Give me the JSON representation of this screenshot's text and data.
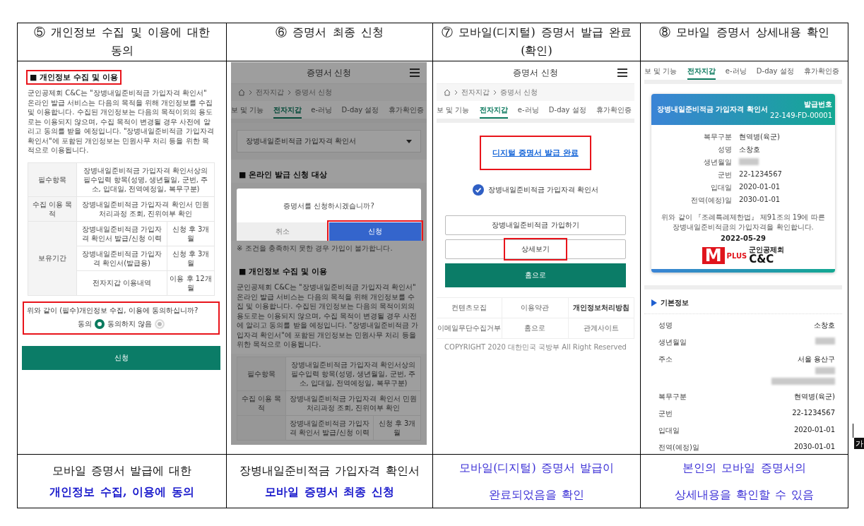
{
  "columns": [
    {
      "header": "⑤ 개인정보 수집 및 이용에 대한 동의",
      "screen": {
        "dimmed": false,
        "blocks": [
          {
            "kind": "heading",
            "text": "■ 개인정보 수집 및 이용",
            "highlighted": true
          },
          {
            "kind": "paragraph",
            "text": "군인공제회 C&C는 \"장병내일준비적금 가입자격 확인서\" 온라인 발급 서비스는 다음의 목적을 위해 개인정보를 수집 및 이용합니다. 수집된 개인정보는 다음의 목적이외의 용도로는 이용되지 않으며, 수집 목적이 변경될 경우 사전에 알리고 동의를 받을 예정입니다. \"장병내일준비적금 가입자격 확인서\"에 포함된 개인정보는 민원사무 처리 등을 위한 목적으로 이용됩니다."
          },
          {
            "kind": "table",
            "rows": [
              {
                "label": "필수항목",
                "detail": "장병내일준비적금 가입자격 확인서상의 필수입력 항목(성명, 생년월일, 군번, 주소, 입대일, 전역예정일, 복무구분)"
              },
              {
                "label": "수집 이용 목적",
                "detail": "장병내일준비적금 가입자격 확인서 민원 처리과정 조회, 진위여부 확인"
              },
              {
                "label": "보유기간",
                "periods": [
                  {
                    "item": "장병내일준비적금 가입자격 확인서 발급/신청 이력",
                    "period": "신청 후 3개월"
                  },
                  {
                    "item": "장병내일준비적금 가입자격 확인서(발급용)",
                    "period": "신청 후 3개월"
                  },
                  {
                    "item": "전자지갑 이용내역",
                    "period": "이용 후 12개월"
                  }
                ]
              }
            ]
          },
          {
            "kind": "consent",
            "question": "위와 같이 (필수)개인정보 수집, 이용에 동의하십니까?",
            "highlighted": true,
            "options": [
              {
                "label": "동의",
                "selected": true
              },
              {
                "label": "동의하지 않음",
                "selected": false
              }
            ]
          },
          {
            "kind": "buttons",
            "buttons": [
              {
                "label": "신청",
                "kind": "primary",
                "highlighted": false
              }
            ]
          }
        ]
      },
      "caption": [
        {
          "text": "모바일 증명서 발급에 대한",
          "kind": "plain"
        },
        {
          "text": "개인정보 수집, 이용에 동의",
          "kind": "strong"
        }
      ]
    },
    {
      "header": "⑥ 증명서 최종 신청",
      "screen": {
        "dimmed": true,
        "blocks": [
          {
            "kind": "appbar",
            "title": "증명서 신청"
          },
          {
            "kind": "breadcrumb",
            "items": [
              "전자지갑",
              "증명서 신청"
            ]
          },
          {
            "kind": "tabs",
            "tabs": [
              {
                "label": "보 및 기능",
                "selected": false
              },
              {
                "label": "전자지갑",
                "selected": true
              },
              {
                "label": "e-러닝",
                "selected": false
              },
              {
                "label": "D-day 설정",
                "selected": false
              },
              {
                "label": "휴가확인증",
                "selected": false
              }
            ]
          },
          {
            "kind": "select",
            "value": "장병내일준비적금 가입자격 확인서"
          },
          {
            "kind": "heading",
            "text": "■ 온라인 발급 신청 대상",
            "highlighted": false
          },
          {
            "kind": "dialog",
            "message": "증명서를 신청하시겠습니까?",
            "buttons": [
              {
                "label": "취소",
                "kind": "cancel",
                "highlighted": false
              },
              {
                "label": "신청",
                "kind": "confirm",
                "highlighted": true
              }
            ]
          },
          {
            "kind": "note",
            "text": "※ 조건을 충족하지 못한 경우 가입이 불가합니다."
          },
          {
            "kind": "heading",
            "text": "■ 개인정보 수집 및 이용",
            "highlighted": false
          },
          {
            "kind": "paragraph",
            "text": "군인공제회 C&C는 \"장병내일준비적금 가입자격 확인서\" 온라인 발급 서비스는 다음의 목적을 위해 개인정보를 수집 및 이용합니다. 수집된 개인정보는 다음의 목적이외의 용도로는 이용되지 않으며, 수집 목적이 변경될 경우 사전에 알리고 동의를 받을 예정입니다. \"장병내일준비적금 가입자격 확인서\"에 포함된 개인정보는 민원사무 처리 등을 위한 목적으로 이용됩니다."
          },
          {
            "kind": "table",
            "rows": [
              {
                "label": "필수항목",
                "detail": "장병내일준비적금 가입자격 확인서상의 필수입력 항목(성명, 생년월일, 군번, 주소, 입대일, 전역예정일, 복무구분)"
              },
              {
                "label": "수집 이용 목적",
                "detail": "장병내일준비적금 가입자격 확인서 민원 처리과정 조회, 진위여부 확인"
              },
              {
                "periods": [
                  {
                    "item": "장병내일준비적금 가입자격 확인서 발급/신청 이력",
                    "period": "신청 후 3개월"
                  }
                ]
              }
            ]
          }
        ]
      },
      "caption": [
        {
          "text": "장병내일준비적금 가입자격 확인서",
          "kind": "plain"
        },
        {
          "text": "모바일 증명서 최종 신청",
          "kind": "strong"
        }
      ]
    },
    {
      "header": "⑦ 모바일(디지털) 증명서 발급 완료 (확인)",
      "screen": {
        "dimmed": false,
        "blocks": [
          {
            "kind": "appbar",
            "title": "증명서 신청"
          },
          {
            "kind": "breadcrumb",
            "items": [
              "전자지갑",
              "증명서 신청"
            ]
          },
          {
            "kind": "tabs",
            "tabs": [
              {
                "label": "보 및 기능",
                "selected": false
              },
              {
                "label": "전자지갑",
                "selected": true
              },
              {
                "label": "e-러닝",
                "selected": false
              },
              {
                "label": "D-day 설정",
                "selected": false
              },
              {
                "label": "휴가확인증",
                "selected": false
              }
            ]
          },
          {
            "kind": "link_title",
            "text": "디지털 증명서 발급 완료",
            "highlighted": true
          },
          {
            "kind": "check_item",
            "text": "장병내일준비적금 가입자격 확인서",
            "checked": true
          },
          {
            "kind": "buttons",
            "buttons": [
              {
                "label": "장병내일준비적금 가입하기",
                "kind": "outline",
                "highlighted": false
              },
              {
                "label": "상세보기",
                "kind": "outline",
                "highlighted": true
              },
              {
                "label": "홈으로",
                "kind": "primary",
                "highlighted": false
              }
            ]
          },
          {
            "kind": "footer",
            "links": [
              {
                "label": "컨텐츠모집",
                "bold": false
              },
              {
                "label": "이용약관",
                "bold": false
              },
              {
                "label": "개인정보처리방침",
                "bold": true
              },
              {
                "label": "이메일무단수집거부",
                "bold": false
              },
              {
                "label": "홈으로",
                "bold": false
              },
              {
                "label": "관계사이트",
                "bold": false
              }
            ],
            "copyright": "COPYRIGHT 2020 대한민국 국방부 All Right Reserved"
          }
        ]
      },
      "caption": [
        {
          "text": "모바일(디지털) 증명서 발급이",
          "kind": "note"
        },
        {
          "text": "완료되었음을 확인",
          "kind": "note"
        }
      ]
    },
    {
      "header": "⑧ 모바일 증명서 상세내용 확인",
      "screen": {
        "dimmed": false,
        "blocks": [
          {
            "kind": "tabs",
            "tabs": [
              {
                "label": "보 및 기능",
                "selected": false
              },
              {
                "label": "전자지갑",
                "selected": true
              },
              {
                "label": "e-러닝",
                "selected": false
              },
              {
                "label": "D-day 설정",
                "selected": false
              },
              {
                "label": "휴가확인증",
                "selected": false
              }
            ]
          },
          {
            "kind": "certificate",
            "title": "장병내일준비적금 가입자격 확인서",
            "number_label": "발급번호",
            "number": "22-149-FD-00001",
            "fields": [
              {
                "label": "복무구분",
                "value": "현역병(육군)",
                "redacted": false
              },
              {
                "label": "성명",
                "value": "소창호",
                "redacted": false
              },
              {
                "label": "생년월일",
                "redacted": true
              },
              {
                "label": "군번",
                "value": "22-1234567",
                "redacted": false
              },
              {
                "label": "입대일",
                "value": "2020-01-01",
                "redacted": false
              },
              {
                "label": "전역(예정)일",
                "value": "2030-01-01",
                "redacted": false
              }
            ],
            "statement": "위와 같이 『조례특례제한법』 제91조의 19에 따른 장병내일준비적금의 가입자격을 확인합니다.",
            "date": "2022-05-29",
            "logo": {
              "mark": "M",
              "badge": "PLUS",
              "org": "군인공제회",
              "name": "C&C"
            }
          },
          {
            "kind": "section_title",
            "text": "기본정보"
          },
          {
            "kind": "details",
            "rows": [
              {
                "label": "성명",
                "value": "소창호",
                "redacted": false
              },
              {
                "label": "생년월일",
                "redacted": true
              },
              {
                "label": "주소",
                "value": "서울 용산구",
                "redacted": true
              },
              {
                "label": "복무구분",
                "value": "현역병(육군)",
                "redacted": false
              },
              {
                "label": "군번",
                "value": "22-1234567",
                "redacted": false
              },
              {
                "label": "입대일",
                "value": "2020-01-01",
                "redacted": false
              },
              {
                "label": "전역(예정)일",
                "value": "2030-01-01",
                "redacted": false
              }
            ]
          }
        ]
      },
      "caption": [
        {
          "text": "본인의 모바일 증명서의",
          "kind": "note"
        },
        {
          "text": "상세내용을 확인할 수 있음",
          "kind": "note"
        }
      ]
    }
  ],
  "ime_indicator": "가"
}
